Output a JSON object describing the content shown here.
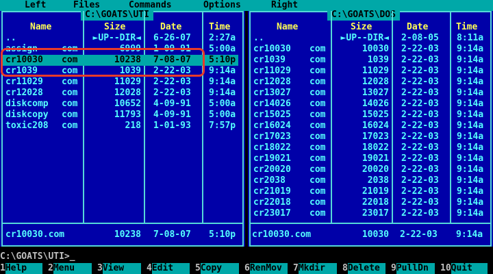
{
  "menu": [
    "Left",
    "Files",
    "Commands",
    "Options",
    "Right"
  ],
  "left_panel": {
    "title": "C:\\GOATS\\UTI",
    "headers": [
      "Name",
      "Size",
      "Date",
      "Time"
    ],
    "rows": [
      {
        "name": "..",
        "ext": "",
        "size": "►UP--DIR◄",
        "date": "6-26-07",
        "time": "2:27a"
      },
      {
        "name": "assign",
        "ext": "com",
        "size": "6999",
        "date": "1-09-91",
        "time": "5:00a"
      },
      {
        "name": "cr10030",
        "ext": "com",
        "size": "10238",
        "date": "7-08-07",
        "time": "5:10p",
        "selected": true
      },
      {
        "name": "cr1039",
        "ext": "com",
        "size": "1039",
        "date": "2-22-03",
        "time": "9:14a"
      },
      {
        "name": "cr11029",
        "ext": "com",
        "size": "11029",
        "date": "2-22-03",
        "time": "9:14a"
      },
      {
        "name": "cr12028",
        "ext": "com",
        "size": "12028",
        "date": "2-22-03",
        "time": "9:14a"
      },
      {
        "name": "diskcomp",
        "ext": "com",
        "size": "10652",
        "date": "4-09-91",
        "time": "5:00a"
      },
      {
        "name": "diskcopy",
        "ext": "com",
        "size": "11793",
        "date": "4-09-91",
        "time": "5:00a"
      },
      {
        "name": "toxic208",
        "ext": "com",
        "size": "218",
        "date": "1-01-93",
        "time": "7:57p"
      }
    ],
    "footer": {
      "file": "cr10030.com",
      "size": "10238",
      "date": "7-08-07",
      "time": "5:10p"
    }
  },
  "right_panel": {
    "title": "C:\\GOATS\\DOS",
    "headers": [
      "Name",
      "Size",
      "Date",
      "Time"
    ],
    "rows": [
      {
        "name": "..",
        "ext": "",
        "size": "►UP--DIR◄",
        "date": "2-08-05",
        "time": "8:11a"
      },
      {
        "name": "cr10030",
        "ext": "com",
        "size": "10030",
        "date": "2-22-03",
        "time": "9:14a"
      },
      {
        "name": "cr1039",
        "ext": "com",
        "size": "1039",
        "date": "2-22-03",
        "time": "9:14a"
      },
      {
        "name": "cr11029",
        "ext": "com",
        "size": "11029",
        "date": "2-22-03",
        "time": "9:14a"
      },
      {
        "name": "cr12028",
        "ext": "com",
        "size": "12028",
        "date": "2-22-03",
        "time": "9:14a"
      },
      {
        "name": "cr13027",
        "ext": "com",
        "size": "13027",
        "date": "2-22-03",
        "time": "9:14a"
      },
      {
        "name": "cr14026",
        "ext": "com",
        "size": "14026",
        "date": "2-22-03",
        "time": "9:14a"
      },
      {
        "name": "cr15025",
        "ext": "com",
        "size": "15025",
        "date": "2-22-03",
        "time": "9:14a"
      },
      {
        "name": "cr16024",
        "ext": "com",
        "size": "16024",
        "date": "2-22-03",
        "time": "9:14a"
      },
      {
        "name": "cr17023",
        "ext": "com",
        "size": "17023",
        "date": "2-22-03",
        "time": "9:14a"
      },
      {
        "name": "cr18022",
        "ext": "com",
        "size": "18022",
        "date": "2-22-03",
        "time": "9:14a"
      },
      {
        "name": "cr19021",
        "ext": "com",
        "size": "19021",
        "date": "2-22-03",
        "time": "9:14a"
      },
      {
        "name": "cr20020",
        "ext": "com",
        "size": "20020",
        "date": "2-22-03",
        "time": "9:14a"
      },
      {
        "name": "cr2038",
        "ext": "com",
        "size": "2038",
        "date": "2-22-03",
        "time": "9:14a"
      },
      {
        "name": "cr21019",
        "ext": "com",
        "size": "21019",
        "date": "2-22-03",
        "time": "9:14a"
      },
      {
        "name": "cr22018",
        "ext": "com",
        "size": "22018",
        "date": "2-22-03",
        "time": "9:14a"
      },
      {
        "name": "cr23017",
        "ext": "com",
        "size": "23017",
        "date": "2-22-03",
        "time": "9:14a"
      }
    ],
    "footer": {
      "file": "cr10030.com",
      "size": "10030",
      "date": "2-22-03",
      "time": "9:14a"
    }
  },
  "command_line": "C:\\GOATS\\UTI>_",
  "function_keys": [
    {
      "num": "1",
      "label": "Help"
    },
    {
      "num": "2",
      "label": "Menu"
    },
    {
      "num": "3",
      "label": "View"
    },
    {
      "num": "4",
      "label": "Edit"
    },
    {
      "num": "5",
      "label": "Copy"
    },
    {
      "num": "6",
      "label": "RenMov"
    },
    {
      "num": "7",
      "label": "Mkdir"
    },
    {
      "num": "8",
      "label": "Delete"
    },
    {
      "num": "9",
      "label": "PullDn"
    },
    {
      "num": "10",
      "label": "Quit"
    }
  ],
  "colors": {
    "panel_bg": "#0000a8",
    "text": "#55ffff",
    "header": "#ffff55",
    "accent": "#00a8a8",
    "annotation": "#e83a2a"
  }
}
